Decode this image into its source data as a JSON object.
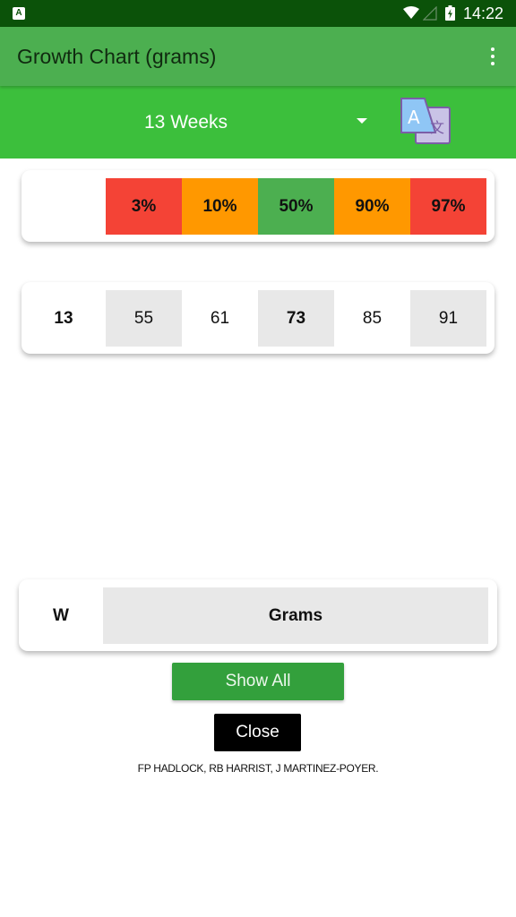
{
  "status_bar": {
    "notification_icon": "app-notification-icon",
    "wifi_icon": "wifi-icon",
    "signal_icon": "cell-signal-icon",
    "battery_icon": "battery-charging-icon",
    "time": "14:22"
  },
  "app_bar": {
    "title": "Growth Chart (grams)",
    "menu_icon": "more-vert-icon"
  },
  "selector": {
    "selected_week": "13 Weeks",
    "dropdown_icon": "dropdown-arrow-icon",
    "translate_icon": "translate-icon"
  },
  "percentiles": {
    "headers": [
      {
        "label": "3%",
        "color": "#f44336"
      },
      {
        "label": "10%",
        "color": "#ff9800"
      },
      {
        "label": "50%",
        "color": "#4caf50"
      },
      {
        "label": "90%",
        "color": "#ff9800"
      },
      {
        "label": "97%",
        "color": "#f44336"
      }
    ]
  },
  "values_row": {
    "week": "13",
    "values": [
      "55",
      "61",
      "73",
      "85",
      "91"
    ]
  },
  "table_header": {
    "week_col": "W",
    "grams_col": "Grams"
  },
  "buttons": {
    "show_all": "Show All",
    "close": "Close"
  },
  "credits": "FP HADLOCK, RB HARRIST, J MARTINEZ-POYER.",
  "colors": {
    "status_bar": "#0b5209",
    "app_bar": "#4caf50",
    "selector_bar": "#3cbf3c",
    "cell_shade": "#e8e8e8",
    "show_all_button": "#33a03c"
  }
}
